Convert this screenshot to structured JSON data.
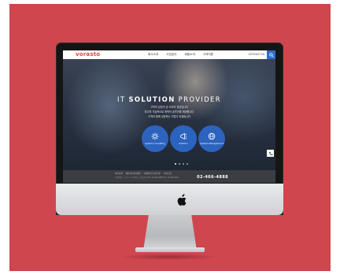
{
  "site": {
    "logo": "vorasto",
    "menu": [
      "회사소개",
      "사업분야",
      "제품소개",
      "고객지원"
    ],
    "util_text": "SITEMAP  EN"
  },
  "hero": {
    "title_pre": "IT ",
    "title_bold": "SOLUTION",
    "title_post": " PROVIDER",
    "subtitle_lines": [
      "고객의 성공이 곧 우리의 성공입니다",
      "최고의 기술력으로 최적의 솔루션을 제공합니다",
      "고객과 함께 성장하는 기업이 되겠습니다"
    ],
    "services": [
      {
        "label": "System consulting",
        "icon": "gear-icon"
      },
      {
        "label": "Solution",
        "icon": "megaphone-icon"
      },
      {
        "label": "System Management",
        "icon": "globe-icon"
      }
    ],
    "slide_count": 4,
    "active_slide": 1
  },
  "footer": {
    "links": [
      "회사소개",
      "개인정보처리방침",
      "이메일무단수집거부",
      "사이트맵"
    ],
    "address": "서울특별시 ○○구 ○○로 000 ○○빌딩 0층   TEL. 02-466-4888   FAX. 02-000-0000",
    "phone": "02-466-4888"
  },
  "colors": {
    "background": "#d0464f",
    "accent": "#2a6fd1",
    "logo": "#e0443c"
  }
}
